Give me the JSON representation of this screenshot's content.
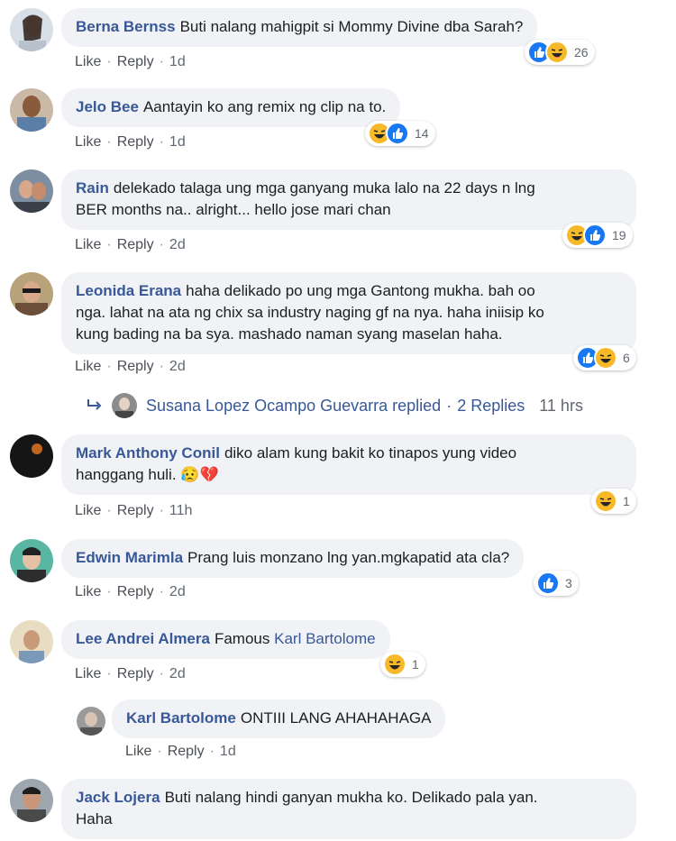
{
  "colors": {
    "link": "#385898",
    "like": "#1877f2",
    "haha": "#f7b928",
    "bubble": "#f0f2f5"
  },
  "action_labels": {
    "like": "Like",
    "reply": "Reply"
  },
  "comments": [
    {
      "author": "Berna Bernss",
      "text": "Buti nalang mahigpit si Mommy Divine dba Sarah?",
      "time": "1d",
      "reaction_count": "26",
      "reactions": [
        "like-icon",
        "haha-icon"
      ]
    },
    {
      "author": "Jelo Bee",
      "text": "Aantayin ko ang remix ng clip na to.",
      "time": "1d",
      "reaction_count": "14",
      "reactions": [
        "haha-icon",
        "like-icon"
      ]
    },
    {
      "author": "Rain",
      "text_line1": "delekado talaga ung mga ganyang muka lalo na 22 days n lng",
      "text_line2": "BER months na.. alright... hello jose mari chan",
      "time": "2d",
      "reaction_count": "19",
      "reactions": [
        "haha-icon",
        "like-icon"
      ]
    },
    {
      "author": "Leonida Erana",
      "text_line1": "haha delikado po ung mga Gantong mukha. bah oo",
      "text_line2": "nga. lahat na ata ng chix sa industry naging gf na nya. haha iniisip ko",
      "text_line3": "kung bading na ba sya. mashado naman syang maselan haha.",
      "time": "2d",
      "reaction_count": "6",
      "reactions": [
        "like-icon",
        "haha-icon"
      ]
    },
    {
      "author": "Mark Anthony Conil",
      "text_line1": "diko alam kung bakit ko tinapos yung video",
      "text_line2": "hanggang huli.",
      "emoji": "😥💔",
      "time": "11h",
      "reaction_count": "1",
      "reactions": [
        "haha-icon"
      ]
    },
    {
      "author": "Edwin Marimla",
      "text": "Prang luis monzano lng yan.mgkapatid ata cla?",
      "time": "2d",
      "reaction_count": "3",
      "reactions": [
        "like-icon"
      ]
    },
    {
      "author": "Lee Andrei Almera",
      "text": "Famous",
      "mention": "Karl Bartolome",
      "time": "2d",
      "reaction_count": "1",
      "reactions": [
        "haha-icon"
      ]
    },
    {
      "author": "Karl Bartolome",
      "text": "ONTIII LANG AHAHAHAGA",
      "time": "1d"
    },
    {
      "author": "Jack Lojera",
      "text_line1": "Buti nalang hindi ganyan mukha ko. Delikado pala yan.",
      "text_line2": "Haha"
    }
  ],
  "replied_row": {
    "name": "Susana Lopez Ocampo Guevarra replied",
    "sep": "·",
    "replies": "2 Replies",
    "time": "11 hrs"
  }
}
